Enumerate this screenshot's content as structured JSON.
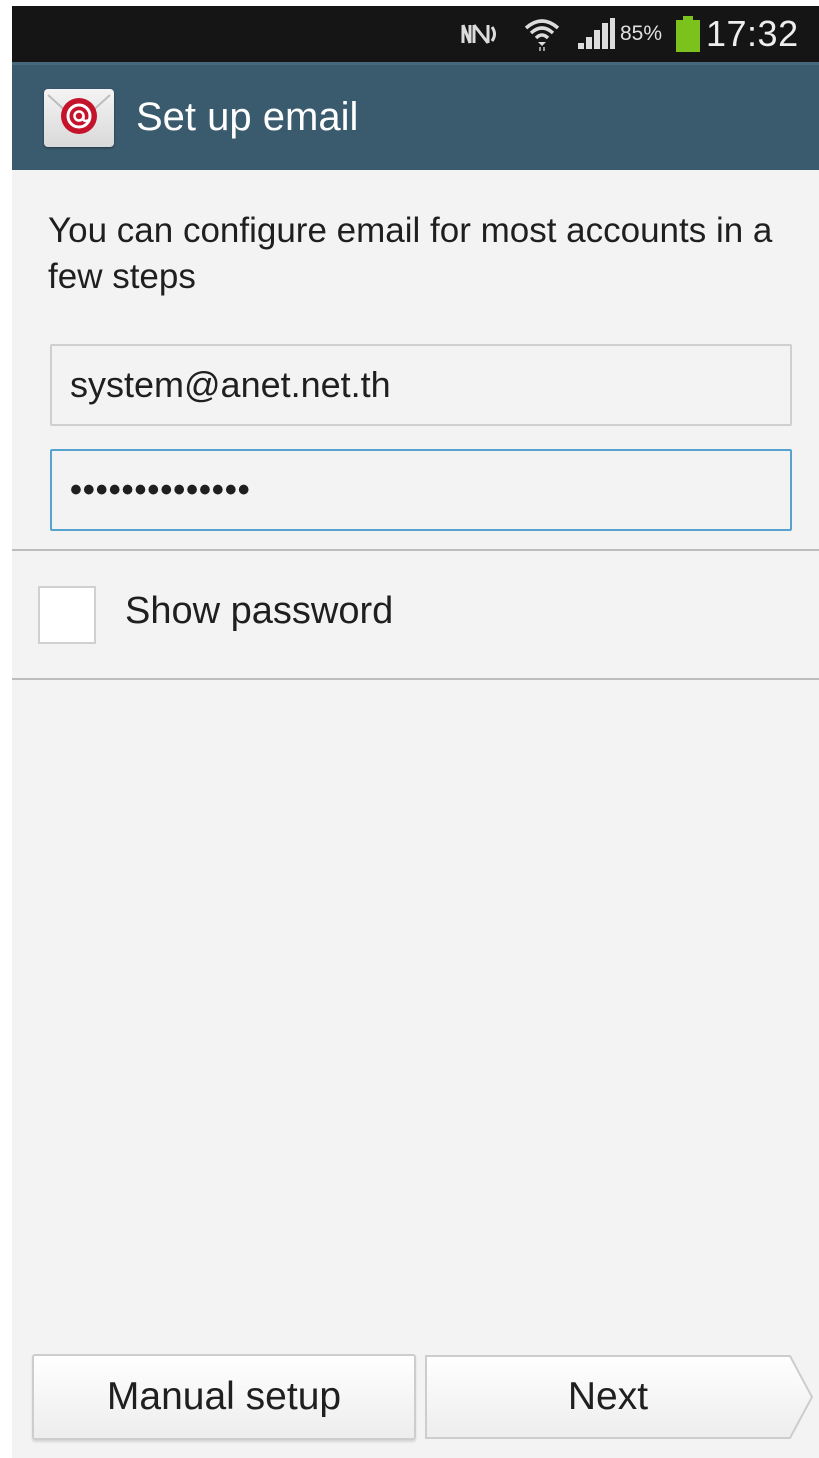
{
  "status_bar": {
    "battery_percent": "85%",
    "time": "17:32",
    "icons": [
      "nfc-icon",
      "wifi-icon",
      "signal-icon",
      "battery-icon"
    ],
    "battery_color": "#7cc21c"
  },
  "action_bar": {
    "title": "Set up email",
    "icon": "email-app-icon",
    "background": "#3a5a6e"
  },
  "form": {
    "intro": "You can configure email for most accounts in a few steps",
    "email_value": "system@anet.net.th",
    "password_masked": "••••••••••••••",
    "show_password_label": "Show password",
    "show_password_checked": false
  },
  "buttons": {
    "manual_setup": "Manual setup",
    "next": "Next"
  }
}
